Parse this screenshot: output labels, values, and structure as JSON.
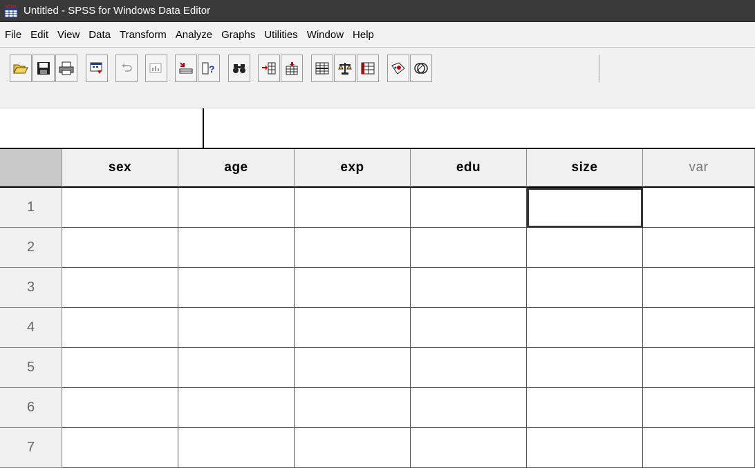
{
  "window": {
    "title": "Untitled - SPSS for Windows Data Editor",
    "app_icon_label": "SPSS"
  },
  "menu": [
    "File",
    "Edit",
    "View",
    "Data",
    "Transform",
    "Analyze",
    "Graphs",
    "Utilities",
    "Window",
    "Help"
  ],
  "toolbar": {
    "buttons": [
      {
        "name": "open-file-icon"
      },
      {
        "name": "save-icon"
      },
      {
        "name": "print-icon"
      },
      {
        "name": "dialog-recall-icon"
      },
      {
        "name": "undo-icon"
      },
      {
        "name": "goto-chart-icon"
      },
      {
        "name": "goto-case-icon"
      },
      {
        "name": "variables-info-icon"
      },
      {
        "name": "find-binoculars-icon"
      },
      {
        "name": "insert-case-icon"
      },
      {
        "name": "insert-variable-icon"
      },
      {
        "name": "split-file-icon"
      },
      {
        "name": "weight-cases-icon"
      },
      {
        "name": "select-cases-icon"
      },
      {
        "name": "value-labels-icon"
      },
      {
        "name": "use-sets-icon"
      }
    ]
  },
  "cell_editor": {
    "reference": "",
    "value": ""
  },
  "grid": {
    "columns": [
      "sex",
      "age",
      "exp",
      "edu",
      "size",
      "var"
    ],
    "rows": [
      "1",
      "2",
      "3",
      "4",
      "5",
      "6",
      "7"
    ],
    "active_cell": {
      "row": "1",
      "column": "size"
    }
  },
  "colors": {
    "title_bar": "#3a3a3a",
    "menu_bar": "#f2f2f2",
    "header_bg": "#f0f0f0",
    "corner_bg": "#c8c8c8",
    "grid_line": "#555555"
  }
}
